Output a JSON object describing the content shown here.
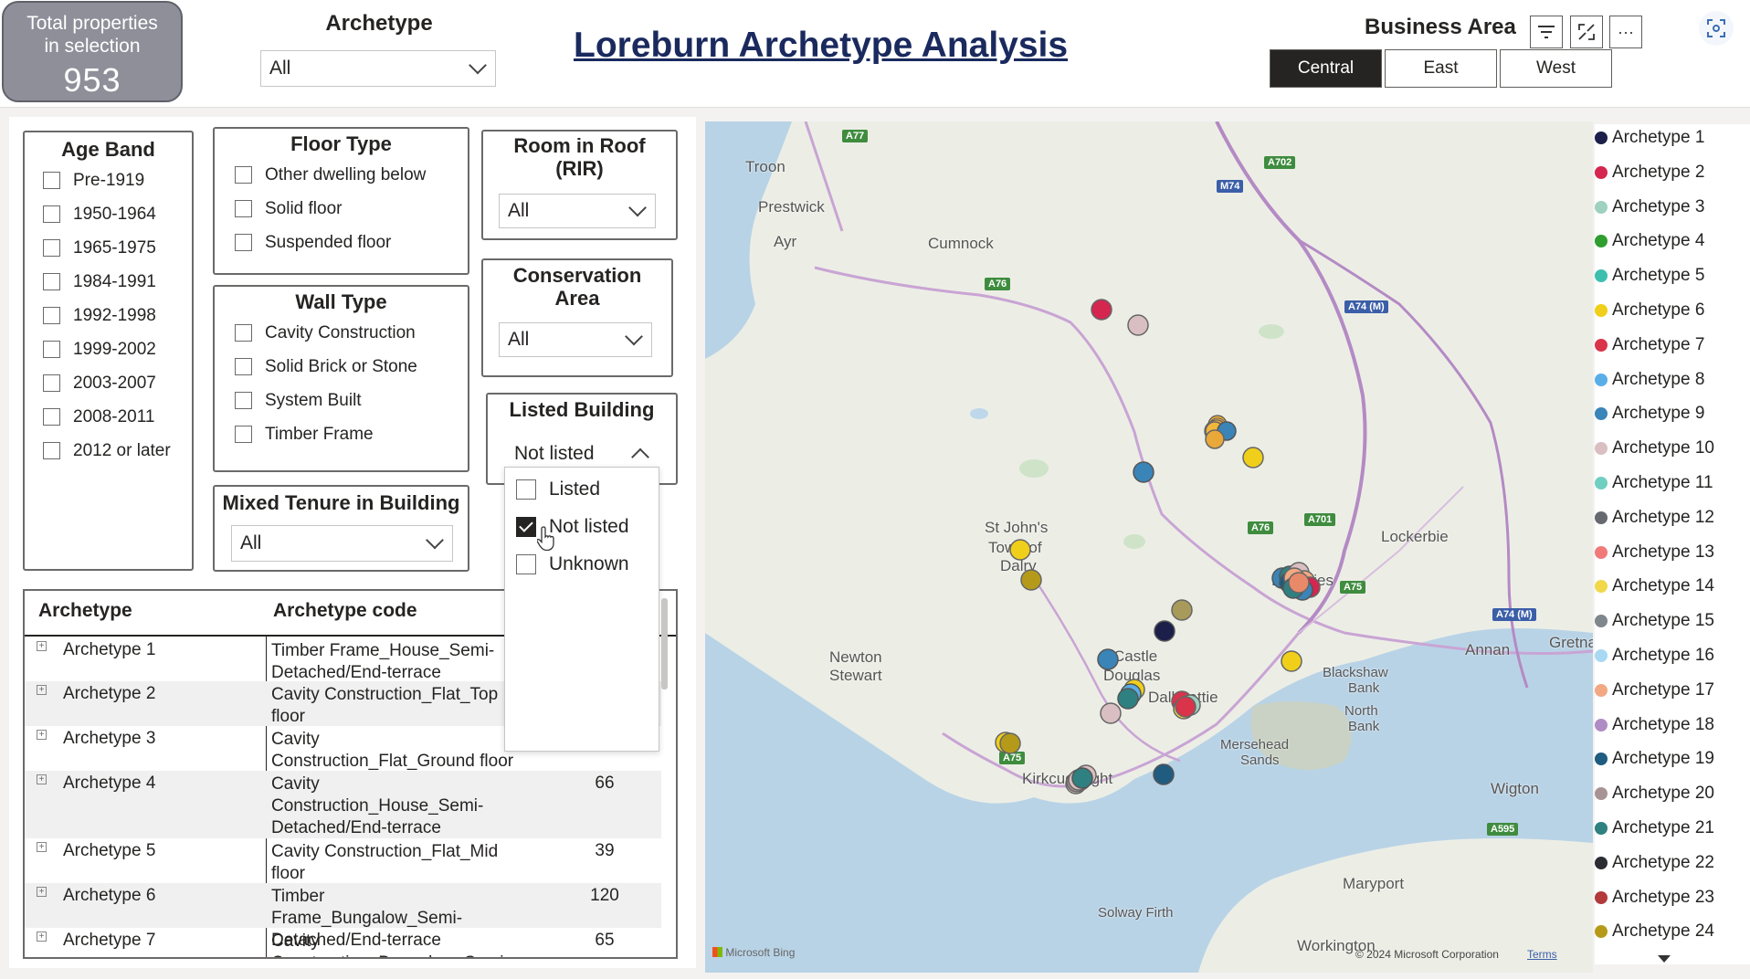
{
  "header": {
    "total_label_line1": "Total properties",
    "total_label_line2": "in selection",
    "total_value": "953",
    "archetype_label": "Archetype",
    "archetype_value": "All",
    "title": "Loreburn Archetype Analysis",
    "business_area_label": "Business Area",
    "business_area_options": [
      "Central",
      "East",
      "West"
    ],
    "business_area_selected": "Central",
    "tools": {
      "filter_icon": "filter-icon",
      "focus_icon": "focus-mode-icon",
      "more_icon": "more-options-icon",
      "capture_icon": "screenshot-icon"
    },
    "more_glyph": "···"
  },
  "filters": {
    "age_band": {
      "title": "Age Band",
      "options": [
        "Pre-1919",
        "1950-1964",
        "1965-1975",
        "1984-1991",
        "1992-1998",
        "1999-2002",
        "2003-2007",
        "2008-2011",
        "2012 or later"
      ]
    },
    "floor_type": {
      "title": "Floor Type",
      "options": [
        "Other dwelling below",
        "Solid floor",
        "Suspended floor"
      ]
    },
    "wall_type": {
      "title": "Wall Type",
      "options": [
        "Cavity Construction",
        "Solid Brick or Stone",
        "System Built",
        "Timber Frame"
      ]
    },
    "mixed_tenure": {
      "title": "Mixed Tenure in Building",
      "value": "All"
    },
    "room_in_roof": {
      "title_line1": "Room in Roof",
      "title_line2": "(RIR)",
      "value": "All"
    },
    "conservation_area": {
      "title_line1": "Conservation",
      "title_line2": "Area",
      "value": "All"
    },
    "listed_building": {
      "title": "Listed Building",
      "value": "Not listed",
      "options": [
        {
          "label": "Listed",
          "checked": false
        },
        {
          "label": "Not listed",
          "checked": true
        },
        {
          "label": "Unknown",
          "checked": false
        }
      ]
    }
  },
  "table": {
    "headers": [
      "Archetype",
      "Archetype code"
    ],
    "rows": [
      {
        "name": "Archetype 1",
        "code": "Timber Frame_House_Semi-Detached/End-terrace",
        "count": ""
      },
      {
        "name": "Archetype 2",
        "code": "Cavity Construction_Flat_Top floor",
        "count": ""
      },
      {
        "name": "Archetype 3",
        "code": "Cavity Construction_Flat_Ground floor",
        "count": ""
      },
      {
        "name": "Archetype 4",
        "code": "Cavity Construction_House_Semi-Detached/End-terrace",
        "count": "66"
      },
      {
        "name": "Archetype 5",
        "code": "Cavity Construction_Flat_Mid floor",
        "count": "39"
      },
      {
        "name": "Archetype 6",
        "code": "Timber Frame_Bungalow_Semi-Detached/End-terrace",
        "count": "120"
      },
      {
        "name": "Archetype 7",
        "code": "Cavity Construction_Bungalow_Semi-",
        "count": "65"
      }
    ]
  },
  "map": {
    "labels": [
      "Troon",
      "Prestwick",
      "Ayr",
      "Cumnock",
      "St John's",
      "Town of",
      "Dalry",
      "Newton",
      "Stewart",
      "Castle",
      "Douglas",
      "Dalbeattie",
      "Kirkcudbright",
      "Lockerbie",
      "Dumfries",
      "Annan",
      "Gretna",
      "Blackshaw",
      "Bank",
      "North",
      "Bank",
      "Mersehead",
      "Sands",
      "Wigton",
      "Maryport",
      "Workington",
      "Solway Firth"
    ],
    "roads": [
      "A77",
      "A702",
      "M74",
      "A76",
      "A74 (M)",
      "A701",
      "A76",
      "A75",
      "A74 (M)",
      "A75",
      "A595"
    ],
    "attribution": "Microsoft Bing",
    "copyright": "© 2024 Microsoft Corporation",
    "terms": "Terms"
  },
  "legend": {
    "items": [
      {
        "name": "Archetype 1",
        "color": "#1b1f4a"
      },
      {
        "name": "Archetype 2",
        "color": "#d4264f"
      },
      {
        "name": "Archetype 3",
        "color": "#9fd1c0"
      },
      {
        "name": "Archetype 4",
        "color": "#2e9e2e"
      },
      {
        "name": "Archetype 5",
        "color": "#3dbfb0"
      },
      {
        "name": "Archetype 6",
        "color": "#f0cf1a"
      },
      {
        "name": "Archetype 7",
        "color": "#d9344a"
      },
      {
        "name": "Archetype 8",
        "color": "#5aaee8"
      },
      {
        "name": "Archetype 9",
        "color": "#3a84b8"
      },
      {
        "name": "Archetype 10",
        "color": "#d9bfc2"
      },
      {
        "name": "Archetype 11",
        "color": "#6fcfc0"
      },
      {
        "name": "Archetype 12",
        "color": "#666a70"
      },
      {
        "name": "Archetype 13",
        "color": "#f07a7a"
      },
      {
        "name": "Archetype 14",
        "color": "#f0d84a"
      },
      {
        "name": "Archetype 15",
        "color": "#7f868c"
      },
      {
        "name": "Archetype 16",
        "color": "#a9d8f2"
      },
      {
        "name": "Archetype 17",
        "color": "#f2a983"
      },
      {
        "name": "Archetype 18",
        "color": "#b08cc4"
      },
      {
        "name": "Archetype 19",
        "color": "#1f5c80"
      },
      {
        "name": "Archetype 20",
        "color": "#a89394"
      },
      {
        "name": "Archetype 21",
        "color": "#2f8080"
      },
      {
        "name": "Archetype 22",
        "color": "#2b2d33"
      },
      {
        "name": "Archetype 23",
        "color": "#b23a3a"
      },
      {
        "name": "Archetype 24",
        "color": "#b59a1a"
      }
    ]
  }
}
